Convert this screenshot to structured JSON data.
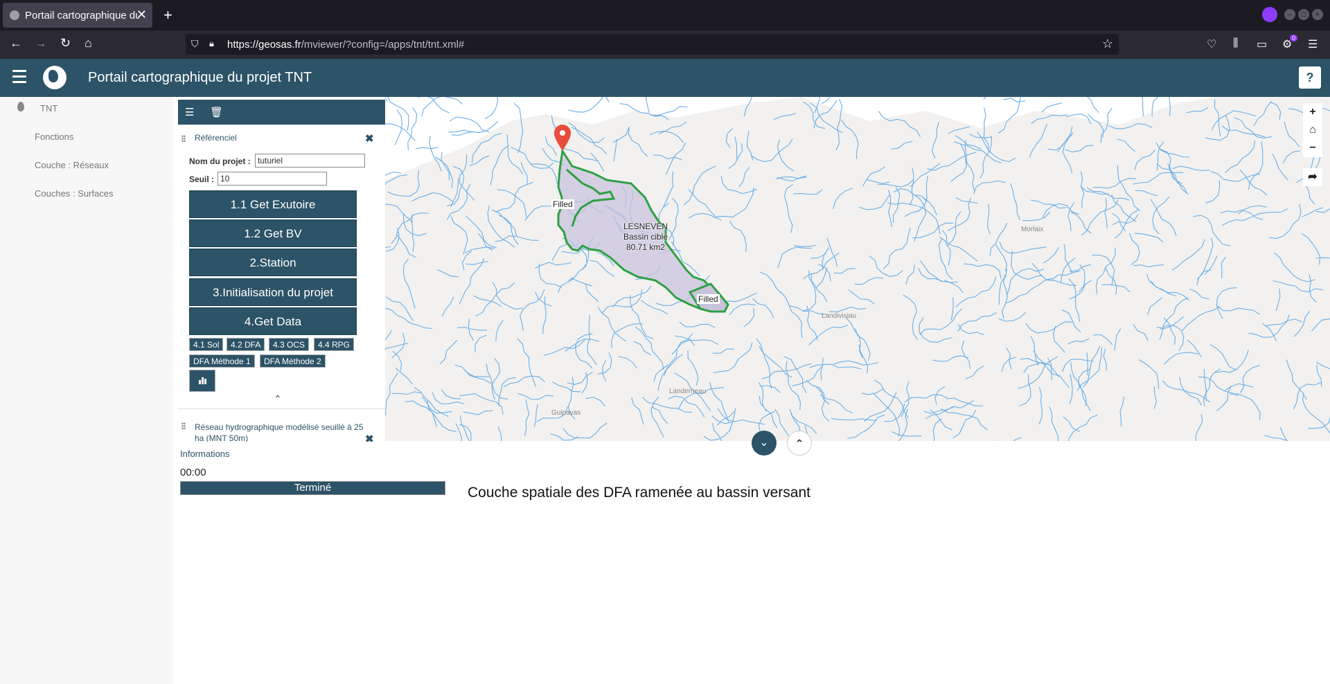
{
  "browser": {
    "tab_title": "Portail cartographique du projet TNT",
    "url_host": "https://geosas.fr",
    "url_path": "/mviewer/?config=/apps/tnt/tnt.xml#",
    "new_tab": "+",
    "close_tab": "✕",
    "badge_count": "0"
  },
  "header": {
    "title": "Portail cartographique du projet TNT",
    "help": "?"
  },
  "sidebar": {
    "items": [
      {
        "label": "TNT"
      },
      {
        "label": "Fonctions"
      },
      {
        "label": "Couche : Réseaux"
      },
      {
        "label": "Couches : Surfaces"
      }
    ]
  },
  "panel": {
    "layer1_title": "Référenciel",
    "project_label": "Nom du projet :",
    "project_value": "tuturiel",
    "seuil_label": "Seuil :",
    "seuil_value": "10",
    "buttons": [
      "1.1 Get Exutoire",
      "1.2 Get BV",
      "2.Station",
      "3.Initialisation du projet",
      "4.Get Data"
    ],
    "small_buttons": [
      "4.1 Sol",
      "4.2 DFA",
      "4.3 OCS",
      "4.4 RPG",
      "DFA Méthode 1",
      "DFA Méthode 2"
    ],
    "layer2_title": "Réseau hydrographique modélisé seuillé à 25 ha (MNT 50m)"
  },
  "map": {
    "labels": {
      "filled1": "Filled",
      "filled2": "Filled",
      "town": "LESNEVEN",
      "basin": "Bassin cible",
      "area": "80.71 km2"
    },
    "places": [
      "Morlaix",
      "Landivisiau",
      "Landerneau",
      "Guipavas"
    ],
    "controls": {
      "zoom_in": "+",
      "home": "⌂",
      "zoom_out": "−",
      "share": "➦"
    }
  },
  "info": {
    "title": "Informations",
    "timer": "00:00",
    "status": "Terminé",
    "caption": "Couche spatiale des DFA ramenée au bassin versant"
  },
  "colors": {
    "primary": "#2c5367",
    "river": "#6aaee8",
    "basin_outline": "#2ea043",
    "basin_fill": "#c9c3dd",
    "marker": "#e74c3c"
  }
}
